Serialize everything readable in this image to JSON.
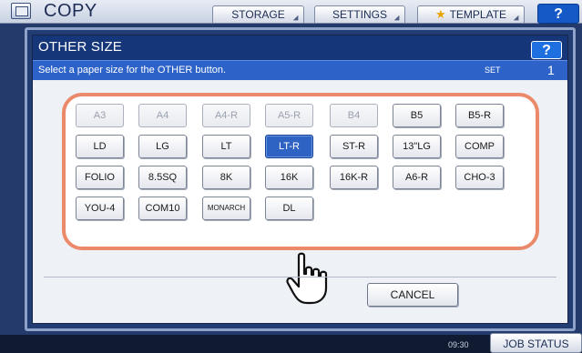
{
  "app": {
    "title": "COPY",
    "top_buttons": {
      "storage": "STORAGE",
      "settings": "SETTINGS",
      "template": "TEMPLATE",
      "help": "?"
    },
    "time": "09:30",
    "job_status": "JOB STATUS"
  },
  "dialog": {
    "title": "OTHER SIZE",
    "help": "?",
    "message": "Select a paper size for the OTHER button.",
    "set_label": "SET",
    "set_value": "1",
    "sizes": [
      {
        "label": "A3",
        "state": "disabled"
      },
      {
        "label": "A4",
        "state": "disabled"
      },
      {
        "label": "A4-R",
        "state": "disabled"
      },
      {
        "label": "A5-R",
        "state": "disabled"
      },
      {
        "label": "B4",
        "state": "disabled"
      },
      {
        "label": "B5",
        "state": "normal"
      },
      {
        "label": "B5-R",
        "state": "normal"
      },
      {
        "label": "LD",
        "state": "normal"
      },
      {
        "label": "LG",
        "state": "normal"
      },
      {
        "label": "LT",
        "state": "normal"
      },
      {
        "label": "LT-R",
        "state": "selected"
      },
      {
        "label": "ST-R",
        "state": "normal"
      },
      {
        "label": "13\"LG",
        "state": "normal"
      },
      {
        "label": "COMP",
        "state": "normal"
      },
      {
        "label": "FOLIO",
        "state": "normal"
      },
      {
        "label": "8.5SQ",
        "state": "normal"
      },
      {
        "label": "8K",
        "state": "normal"
      },
      {
        "label": "16K",
        "state": "normal"
      },
      {
        "label": "16K-R",
        "state": "normal"
      },
      {
        "label": "A6-R",
        "state": "normal"
      },
      {
        "label": "CHO-3",
        "state": "normal"
      },
      {
        "label": "YOU-4",
        "state": "normal"
      },
      {
        "label": "COM10",
        "state": "normal"
      },
      {
        "label": "MONARCH",
        "state": "normal"
      },
      {
        "label": "DL",
        "state": "normal"
      }
    ],
    "cancel": "CANCEL"
  },
  "colors": {
    "frame_accent": "#eb8a6a",
    "selected": "#2f63c3",
    "header": "#15377a",
    "message_bar": "#2d63c8"
  }
}
